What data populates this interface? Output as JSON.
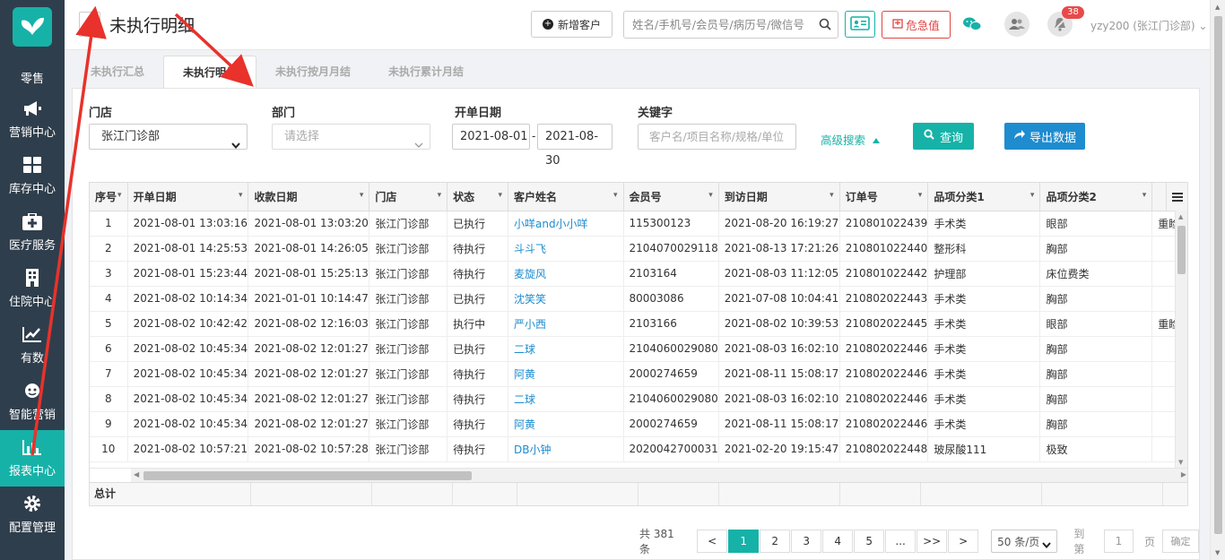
{
  "sidebar": {
    "items": [
      {
        "label": "零售",
        "icon": "retail-icon"
      },
      {
        "label": "营销中心",
        "icon": "megaphone-icon"
      },
      {
        "label": "库存中心",
        "icon": "grid-icon"
      },
      {
        "label": "医疗服务",
        "icon": "medical-kit-icon"
      },
      {
        "label": "住院中心",
        "icon": "building-icon"
      },
      {
        "label": "有数",
        "icon": "trend-chart-icon"
      },
      {
        "label": "智能营销",
        "icon": "smart-marketing-icon"
      },
      {
        "label": "报表中心",
        "icon": "bar-chart-icon"
      },
      {
        "label": "配置管理",
        "icon": "gear-icon"
      }
    ]
  },
  "header": {
    "back_label": "‹",
    "title": "未执行明细",
    "new_client": "新增客户",
    "search_placeholder": "姓名/手机号/会员号/病历号/微信号",
    "danger_label": "危急值",
    "notification_count": "38",
    "user": "yzy200 (张江门诊部) ⌄"
  },
  "tabs": [
    "未执行汇总",
    "未执行明细",
    "未执行按月月结",
    "未执行累计月结"
  ],
  "filters": {
    "store_label": "门店",
    "store_value": "张江门诊部",
    "dept_label": "部门",
    "dept_placeholder": "请选择",
    "date_label": "开单日期",
    "date_from": "2021-08-01",
    "date_sep": "-",
    "date_to": "2021-08-30",
    "keyword_label": "关键字",
    "keyword_placeholder": "客户名/项目名称/规格/单位",
    "advanced": "高级搜索",
    "query": "查询",
    "export": "导出数据"
  },
  "table": {
    "columns": [
      "序号",
      "开单日期",
      "收款日期",
      "门店",
      "状态",
      "客户姓名",
      "会员号",
      "到访日期",
      "订单号",
      "品项分类1",
      "品项分类2",
      ""
    ],
    "rows": [
      [
        "1",
        "2021-08-01 13:03:16",
        "2021-08-01 13:03:20",
        "张江门诊部",
        "已执行",
        "小咩and小小咩",
        "115300123",
        "2021-08-20 16:19:27",
        "210801022439",
        "手术类",
        "眼部",
        "重睑"
      ],
      [
        "2",
        "2021-08-01 14:25:53",
        "2021-08-01 14:26:05",
        "张江门诊部",
        "待执行",
        "斗斗飞",
        "2104070029118",
        "2021-08-13 17:21:26",
        "210801022440",
        "整形科",
        "胸部",
        ""
      ],
      [
        "3",
        "2021-08-01 15:23:44",
        "2021-08-01 15:25:13",
        "张江门诊部",
        "待执行",
        "麦旋风",
        "2103164",
        "2021-08-03 11:12:05",
        "210801022442",
        "护理部",
        "床位费类",
        ""
      ],
      [
        "4",
        "2021-08-02 10:14:34",
        "2021-01-01 10:14:47",
        "张江门诊部",
        "已执行",
        "沈笑笑",
        "80003086",
        "2021-07-08 10:04:41",
        "210802022443",
        "手术类",
        "胸部",
        ""
      ],
      [
        "5",
        "2021-08-02 10:42:42",
        "2021-08-02 12:16:03",
        "张江门诊部",
        "执行中",
        "严小西",
        "2103166",
        "2021-08-02 10:39:53",
        "210802022445",
        "手术类",
        "眼部",
        "重睑"
      ],
      [
        "6",
        "2021-08-02 10:45:34",
        "2021-08-02 12:01:27",
        "张江门诊部",
        "已执行",
        "二球",
        "2104060029080",
        "2021-08-03 16:02:10",
        "210802022446",
        "手术类",
        "胸部",
        ""
      ],
      [
        "7",
        "2021-08-02 10:45:34",
        "2021-08-02 12:01:27",
        "张江门诊部",
        "待执行",
        "阿黄",
        "2000274659",
        "2021-08-11 15:08:17",
        "210802022446",
        "手术类",
        "胸部",
        ""
      ],
      [
        "8",
        "2021-08-02 10:45:34",
        "2021-08-02 12:01:27",
        "张江门诊部",
        "待执行",
        "二球",
        "2104060029080",
        "2021-08-03 16:02:10",
        "210802022446",
        "手术类",
        "胸部",
        ""
      ],
      [
        "9",
        "2021-08-02 10:45:34",
        "2021-08-02 12:01:27",
        "张江门诊部",
        "待执行",
        "阿黄",
        "2000274659",
        "2021-08-11 15:08:17",
        "210802022446",
        "手术类",
        "胸部",
        ""
      ],
      [
        "10",
        "2021-08-02 10:57:21",
        "2021-08-02 10:57:28",
        "张江门诊部",
        "待执行",
        "DB小钟",
        "2020042700031",
        "2021-02-20 19:15:47",
        "210802022448",
        "玻尿酸111",
        "极致",
        ""
      ]
    ],
    "total_label": "总计"
  },
  "pagination": {
    "total": "共 381 条",
    "prev": "<",
    "pages": [
      "1",
      "2",
      "3",
      "4",
      "5"
    ],
    "ellipsis": "...",
    "jump": ">>",
    "next": ">",
    "page_size": "50 条/页",
    "goto_label": "到第",
    "goto_value": "1",
    "page_unit": "页",
    "confirm": "确定"
  },
  "colors": {
    "sidebar_bg": "#2f3e4c",
    "accent": "#16b2a8",
    "link": "#1e8ccf",
    "danger": "#e04545",
    "annotation_arrow": "#e8322b"
  }
}
